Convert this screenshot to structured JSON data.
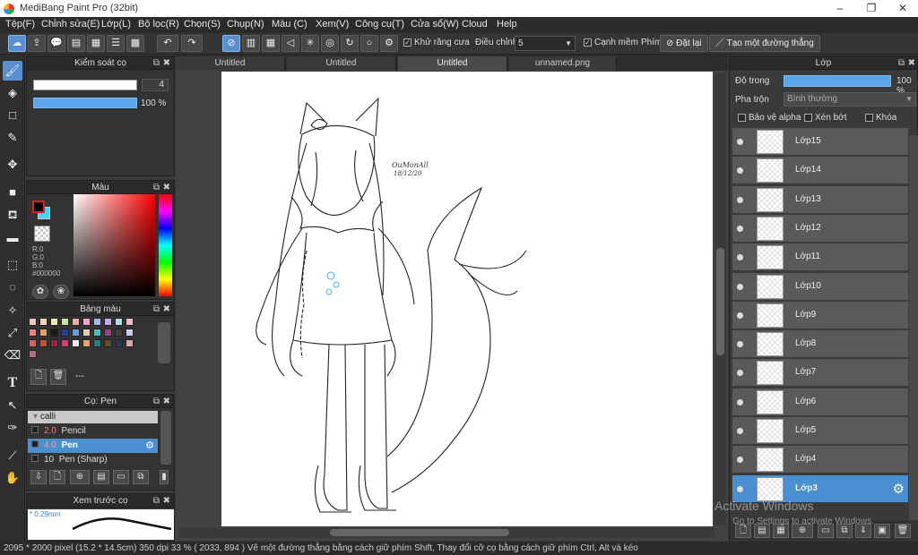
{
  "app": {
    "title": "MediBang Paint Pro (32bit)"
  },
  "menu": [
    "Tệp(F)",
    "Chỉnh sửa(E)",
    "Lớp(L)",
    "Bộ lọc(R)",
    "Chọn(S)",
    "Chụp(N)",
    "Màu (C)",
    "Xem(V)",
    "Công cụ(T)",
    "Cửa sổ(W)",
    "Cloud",
    "Help"
  ],
  "toolbar": {
    "antialias_label": "Khử răng cưa",
    "adjust_label": "Điều chỉnh",
    "adjust_value": "5",
    "smooth_label": "Cạnh mềm",
    "key_label": "Phím",
    "reset_label": "Đặt lại",
    "straight_line_label": "Tạo một đường thẳng"
  },
  "brush_control": {
    "title": "Kiểm soát cọ",
    "size_value": "4",
    "opacity_value": "100 %"
  },
  "color_panel": {
    "title": "Màu",
    "r": "R:0",
    "g": "G:0",
    "b": "B:0",
    "hex": "#000000",
    "primary_color": "#000000",
    "secondary_color": "#4fd0f0"
  },
  "palette": {
    "title": "Bảng màu",
    "name": "---",
    "colors": [
      "#f4c2c2",
      "#f7d3b0",
      "#ffe8a8",
      "#c8e6a0",
      "#f7a8a8",
      "#ff9fd0",
      "#a0b8f0",
      "#c8a8f0",
      "#a8e0f0",
      "#f2b8d8",
      "#f08080",
      "#e8a060",
      "#1a1a1a",
      "#2040a0",
      "#60a0e0",
      "#e8c8a8",
      "#40c0c0",
      "#a04080",
      "#404040",
      "#c8c8f0",
      "#e06060",
      "#c05030",
      "#a02040",
      "#d04080",
      "#f0f0f0",
      "#f0a060",
      "#208080",
      "#605020",
      "#303060",
      "#e0a0b0",
      "#b07080"
    ]
  },
  "brush_panel": {
    "title": "Cọ: Pen",
    "category": "calli",
    "brushes": [
      {
        "size": "2.0",
        "name": "Pencil"
      },
      {
        "size": "4.0",
        "name": "Pen"
      },
      {
        "size": "10",
        "name": "Pen (Sharp)"
      }
    ]
  },
  "preview_panel": {
    "title": "Xem trước cọ",
    "size": "0.29mm"
  },
  "tabs": [
    "Untitled",
    "Untitled",
    "Untitled",
    "unnamed.png"
  ],
  "layer_panel": {
    "title": "Lớp",
    "opacity_label": "Độ trong",
    "opacity_value": "100 %",
    "blend_label": "Pha trộn",
    "blend_value": "Bình thường",
    "protect_alpha": "Bảo vệ alpha",
    "clipping": "Xén bớt",
    "lock": "Khóa",
    "layers": [
      "Lớp15",
      "Lớp14",
      "Lớp13",
      "Lớp12",
      "Lớp11",
      "Lớp10",
      "Lớp9",
      "Lớp8",
      "Lớp7",
      "Lớp6",
      "Lớp5",
      "Lớp4",
      "Lớp3"
    ]
  },
  "watermark": {
    "line1": "Activate Windows",
    "line2": "Go to Settings to activate Windows."
  },
  "statusbar": {
    "text": "2095 * 2000 pixel   (15.2 * 14.5cm)   350 dpi   33 %   ( 2033, 894 )   Vẽ một đường thẳng bằng cách giữ phím Shift, Thay đổi cỡ cọ bằng cách giữ phím Ctrl, Alt và kéo"
  },
  "canvas_signature": [
    "OuMonAll",
    "18/12/20"
  ]
}
